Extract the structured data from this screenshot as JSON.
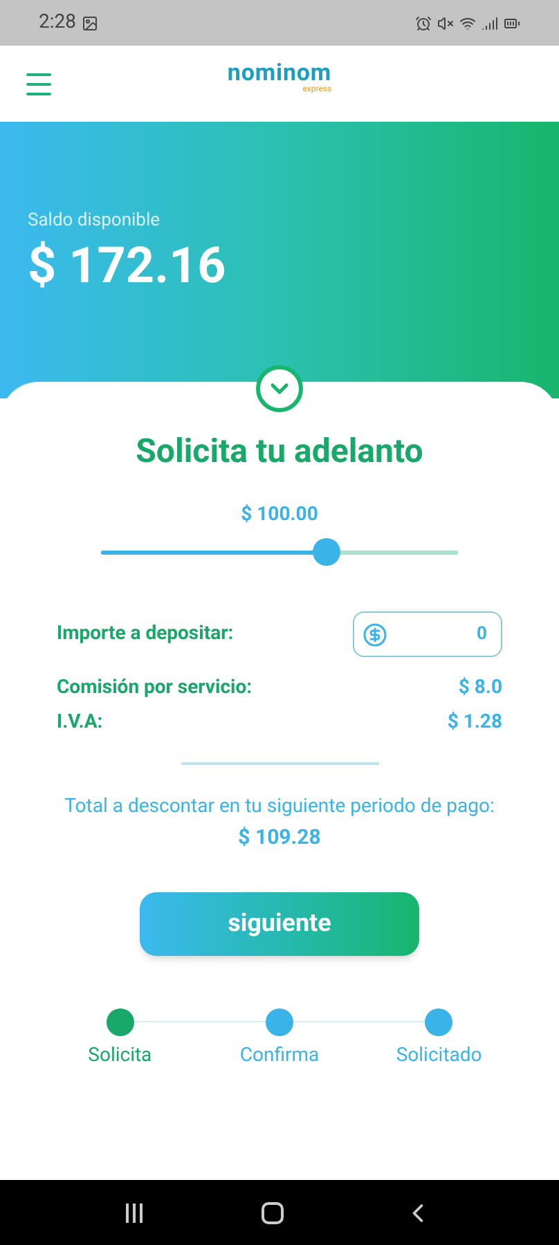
{
  "status_bar": {
    "time": "2:28"
  },
  "header": {
    "logo": "nominom",
    "logo_sub": "express"
  },
  "balance": {
    "label": "Saldo disponible",
    "amount": "$ 172.16"
  },
  "request": {
    "title": "Solicita tu adelanto",
    "amount": "$ 100.00",
    "slider": {
      "level": 0.63
    }
  },
  "deposit": {
    "label": "Importe a depositar:",
    "value": "0"
  },
  "fees": [
    {
      "label": "Comisión por servicio:",
      "value": "$ 8.0"
    },
    {
      "label": "I.V.A:",
      "value": "$ 1.28"
    }
  ],
  "total": {
    "label": "Total a descontar en tu siguiente periodo de pago:",
    "amount": "$ 109.28"
  },
  "button": "siguiente",
  "steps": [
    {
      "label": "Solicita",
      "selected": true
    },
    {
      "label": "Confirma",
      "selected": false
    },
    {
      "label": "Solicitado",
      "selected": false
    }
  ]
}
